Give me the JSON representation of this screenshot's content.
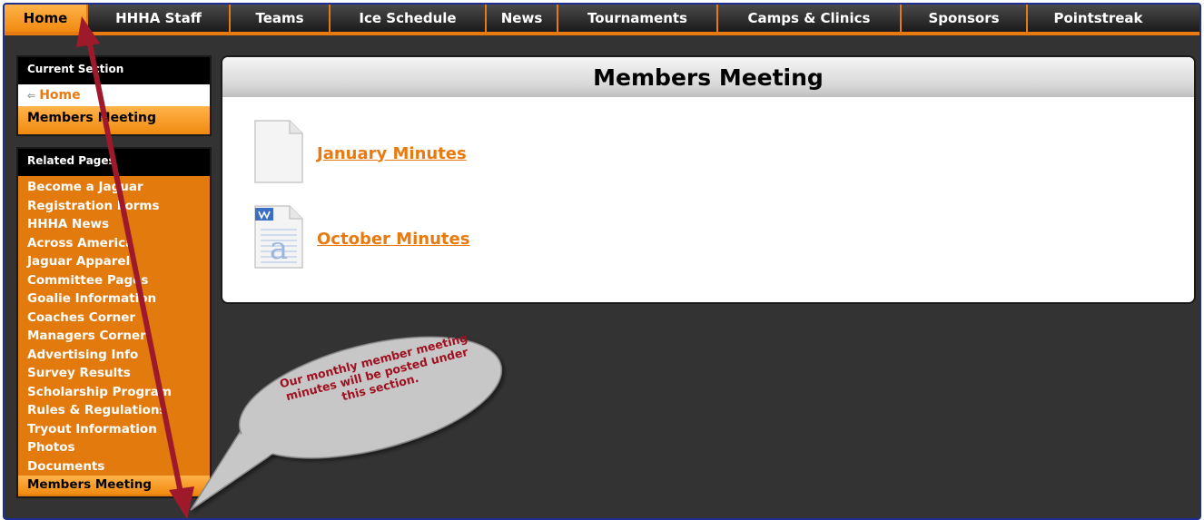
{
  "nav": {
    "items": [
      "Home",
      "HHHA Staff",
      "Teams",
      "Ice Schedule",
      "News",
      "Tournaments",
      "Camps & Clinics",
      "Sponsors",
      "Pointstreak"
    ]
  },
  "sidebar": {
    "current_heading": "Current Section",
    "current_home": "Home",
    "current_page": "Members Meeting",
    "related_heading": "Related Pages",
    "related_items": [
      "Become a Jaguar",
      "Registration Forms",
      "HHHA News",
      "Across America",
      "Jaguar Apparel",
      "Committee Pages",
      "Goalie Information",
      "Coaches Corner",
      "Managers Corner",
      "Advertising Info",
      "Survey Results",
      "Scholarship Program",
      "Rules & Regulations",
      "Tryout Information",
      "Photos",
      "Documents",
      "Members Meeting"
    ]
  },
  "panel": {
    "title": "Members Meeting",
    "documents": [
      {
        "label": "January Minutes",
        "icon": "blank-document-icon"
      },
      {
        "label": "October Minutes",
        "icon": "word-document-icon"
      }
    ]
  },
  "annotation": {
    "text": "Our monthly member meeting minutes will be posted under this section."
  },
  "colors": {
    "accent": "#e87a0f",
    "annotation_text": "#a01020",
    "arrow": "#9e1a2b",
    "frame": "#1f2f8f"
  }
}
